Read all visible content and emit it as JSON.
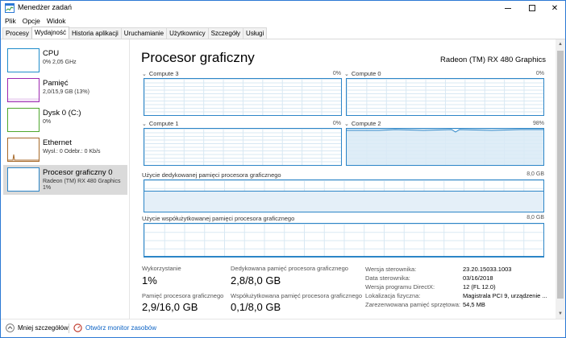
{
  "window": {
    "title": "Menedżer zadań"
  },
  "menu": [
    "Plik",
    "Opcje",
    "Widok"
  ],
  "tabs": [
    {
      "label": "Procesy",
      "active": false
    },
    {
      "label": "Wydajność",
      "active": true
    },
    {
      "label": "Historia aplikacji",
      "active": false
    },
    {
      "label": "Uruchamianie",
      "active": false
    },
    {
      "label": "Użytkownicy",
      "active": false
    },
    {
      "label": "Szczegóły",
      "active": false
    },
    {
      "label": "Usługi",
      "active": false
    }
  ],
  "sidebar": {
    "items": [
      {
        "title": "CPU",
        "subtitle": "0% 2,05 GHz",
        "color": "#1f8ccb"
      },
      {
        "title": "Pamięć",
        "subtitle": "2,0/15,9 GB (13%)",
        "color": "#9c28b1"
      },
      {
        "title": "Dysk 0 (C:)",
        "subtitle": "0%",
        "color": "#4ea72c"
      },
      {
        "title": "Ethernet",
        "subtitle": "Wysł.: 0 Odebr.: 0 Kb/s",
        "color": "#a76a2b"
      },
      {
        "title": "Procesor graficzny 0",
        "subtitle": "Radeon (TM) RX 480 Graphics",
        "subtitle2": "1%",
        "color": "#2c85c7",
        "selected": true
      }
    ]
  },
  "main": {
    "title": "Procesor graficzny",
    "device": "Radeon (TM) RX 480 Graphics",
    "engines": [
      {
        "name": "Compute 3",
        "pct": "0%"
      },
      {
        "name": "Compute 0",
        "pct": "0%"
      },
      {
        "name": "Compute 1",
        "pct": "0%"
      },
      {
        "name": "Compute 2",
        "pct": "98%"
      }
    ],
    "dedicated": {
      "label": "Użycie dedykowanej pamięci procesora graficznego",
      "max": "8,0 GB"
    },
    "shared": {
      "label": "Użycie współużytkowanej pamięci procesora graficznego",
      "max": "8,0 GB"
    },
    "stats": {
      "util_label": "Wykorzystanie",
      "util_value": "1%",
      "gpumem_label": "Pamięć procesora graficznego",
      "gpumem_value": "2,9/16,0 GB",
      "ded_label": "Dedykowana pamięć procesora graficznego",
      "ded_value": "2,8/8,0 GB",
      "shared_label": "Współużytkowana pamięć procesora graficznego",
      "shared_value": "0,1/8,0 GB"
    },
    "info": [
      {
        "key": "Wersja sterownika:",
        "value": "23.20.15033.1003"
      },
      {
        "key": "Data sterownika:",
        "value": "03/16/2018"
      },
      {
        "key": "Wersja programu DirectX:",
        "value": "12 (FL 12.0)"
      },
      {
        "key": "Lokalizacja fizyczna:",
        "value": "Magistrala PCI 9, urządzenie ..."
      },
      {
        "key": "Zarezerwowana pamięć sprzętowa:",
        "value": "54,5 MB"
      }
    ]
  },
  "footer": {
    "fewer_details": "Mniej szczegółów",
    "resource_monitor": "Otwórz monitor zasobów"
  }
}
